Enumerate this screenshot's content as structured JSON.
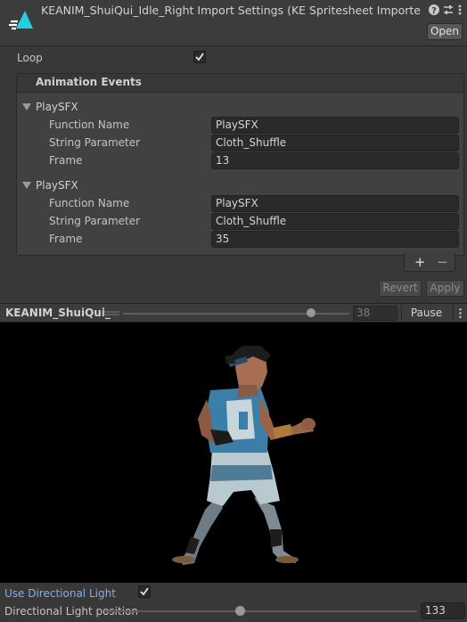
{
  "window": {
    "title": "KEANIM_ShuiQui_Idle_Right Import Settings (KE Spritesheet Importer)",
    "open_label": "Open",
    "header_icons": [
      "help-icon",
      "settings-sliders-icon",
      "kebab-menu-icon"
    ]
  },
  "loop": {
    "label": "Loop",
    "checked": true
  },
  "animation_events": {
    "title": "Animation Events",
    "events": [
      {
        "name": "PlaySFX",
        "function_label": "Function Name",
        "function_value": "PlaySFX",
        "string_label": "String Parameter",
        "string_value": "Cloth_Shuffle",
        "frame_label": "Frame",
        "frame_value": "13"
      },
      {
        "name": "PlaySFX",
        "function_label": "Function Name",
        "function_value": "PlaySFX",
        "string_label": "String Parameter",
        "string_value": "Cloth_Shuffle",
        "frame_label": "Frame",
        "frame_value": "35"
      }
    ],
    "add_icon": "+",
    "remove_icon": "−"
  },
  "actions": {
    "revert_label": "Revert",
    "apply_label": "Apply"
  },
  "preview": {
    "clip_name": "KEANIM_ShuiQui_",
    "frame_value": "38",
    "timeline_progress": 0.83,
    "pause_label": "Pause"
  },
  "lighting": {
    "use_directional_label": "Use Directional Light",
    "use_directional_checked": true,
    "position_label": "Directional Light position",
    "position_value": "133",
    "position_fraction": 0.43
  },
  "colors": {
    "accent": "#26c6da",
    "link_label": "#7bb2e8",
    "background": "#383838"
  }
}
